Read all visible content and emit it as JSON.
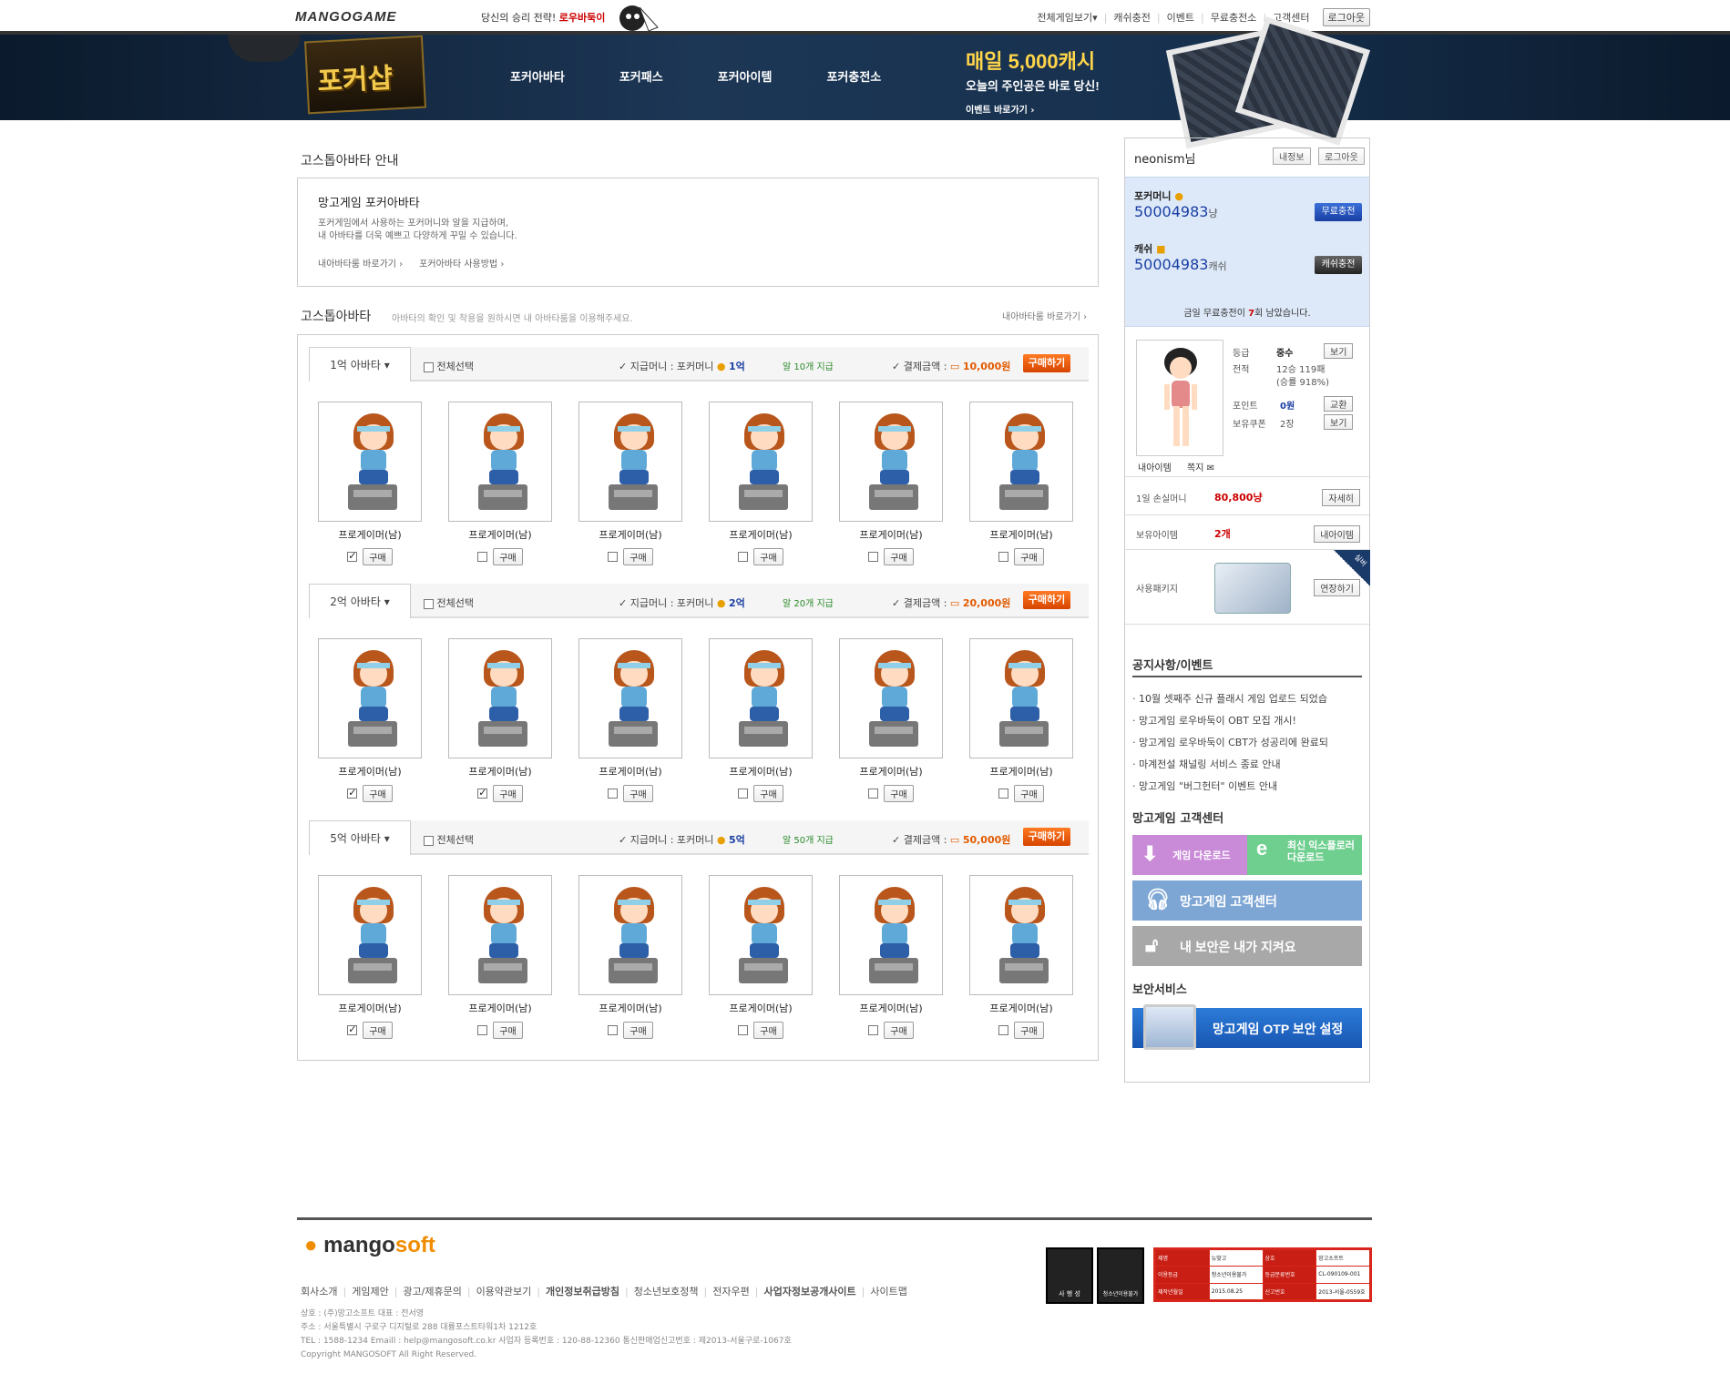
{
  "topbar": {
    "logo": "MANGOGAME",
    "promo_text": "당신의 승리 전략!",
    "promo_link": "로우바둑이",
    "nav": [
      "전체게임보기",
      "캐쉬충전",
      "이벤트",
      "무료충전소",
      "고객센터"
    ],
    "logout": "로그아웃"
  },
  "banner": {
    "shop_title": "포커샵",
    "nav": [
      "포커아바타",
      "포커패스",
      "포커아이템",
      "포커충전소"
    ],
    "promo_big": "매일 5,000캐시",
    "promo_mid": "오늘의 주인공은 바로 당신!",
    "promo_link": "이벤트 바로가기 ›"
  },
  "guide": {
    "section_title": "고스톱아바타 안내",
    "title": "망고게임 포커아바타",
    "desc1": "포커게임에서 사용하는 포커머니와 알을 지급하며,",
    "desc2": "내 아바타를 더욱 예쁘고 다양하게 꾸밀 수 있습니다.",
    "link1": "내아바타룸 바로가기 ›",
    "link2": "포커아바타 사용방법 ›"
  },
  "avatars": {
    "section_title": "고스톱아바타",
    "section_desc": "아바타의 확인 및 착용을 원하시면 내 아바타룸을 이용해주세요.",
    "section_link": "내아바타룸 바로가기 ›",
    "select_all": "전체선택",
    "money_label": "✓ 지급머니 : 포커머니",
    "pay_label": "✓ 결제금액 :",
    "buy_label": "구매하기",
    "item_buy": "구매",
    "item_name": "프로게이머(남)",
    "groups": [
      {
        "tab": "1억 아바타 ▾",
        "money": "1억",
        "egg": "알 10개 지급",
        "price": "10,000원",
        "checked": [
          true,
          false,
          false,
          false,
          false,
          false
        ]
      },
      {
        "tab": "2억 아바타 ▾",
        "money": "2억",
        "egg": "알 20개 지급",
        "price": "20,000원",
        "checked": [
          true,
          true,
          false,
          false,
          false,
          false
        ]
      },
      {
        "tab": "5억 아바타 ▾",
        "money": "5억",
        "egg": "알 50개 지급",
        "price": "50,000원",
        "checked": [
          true,
          false,
          false,
          false,
          false,
          false
        ]
      }
    ]
  },
  "sidebar": {
    "user": "neonism님",
    "myinfo": "내정보",
    "logout": "로그아웃",
    "poker_money_label": "포커머니",
    "poker_money_value": "50004983",
    "poker_money_unit": "냥",
    "free_charge": "무료충전",
    "cash_label": "캐쉬",
    "cash_value": "50004983",
    "cash_unit": "캐쉬",
    "cash_charge": "캐쉬충전",
    "free_msg_pre": "금일 무료충전이 ",
    "free_msg_count": "7",
    "free_msg_post": "회 남았습니다.",
    "grade_label": "등급",
    "grade_value": "중수",
    "record_label": "전적",
    "record_value": "12승 119패",
    "record_rate": "(승률 918%)",
    "point_label": "포인트",
    "point_value": "0원",
    "coupon_label": "보유쿠폰",
    "coupon_value": "2장",
    "view": "보기",
    "exchange": "교환",
    "my_item": "내아이템",
    "note": "쪽지",
    "loss_label": "1일 손실머니",
    "loss_value": "80,800냥",
    "loss_btn": "자세히",
    "items_label": "보유아이템",
    "items_value": "2개",
    "items_btn": "내아이템",
    "package_label": "사용패키지",
    "package_btn": "연장하기",
    "package_tag": "실버",
    "notice_title": "공지사항/이벤트",
    "notices": [
      "10월 셋째주 신규 플래시 게임 업로드 되었습",
      "망고게임 로우바둑이 OBT 모집 개시!",
      "망고게임 로우바둑이 CBT가 성공리에 완료되",
      "마계전설 채널링 서비스 종료 안내",
      "망고게임 \"버그헌터\" 이벤트 안내"
    ],
    "cs_title": "망고게임 고객센터",
    "download": "게임 다운로드",
    "explorer": "최신 익스플로러 다운로드",
    "cs_center": "망고게임 고객센터",
    "security": "내 보안은 내가 지켜요",
    "sec_title": "보안서비스",
    "otp": "망고게임 OTP 보안 설정"
  },
  "footer": {
    "logo_a": "mango",
    "logo_b": "soft",
    "links": [
      "회사소개",
      "게임제안",
      "광고/제휴문의",
      "이용약관보기",
      "개인정보취급방침",
      "청소년보호정책",
      "전자우편",
      "사업자정보공개사이트",
      "사이트맵"
    ],
    "info1": "상호 : (주)망고소프트 대표 : 전서영",
    "info2": "주소 : 서울특별시 구로구 디지털로 288 대륭포스트타워1차 1212호",
    "info3": "TEL : 1588-1234 Emaill : help@mangosoft.co.kr 사업자 등록번호 : 120-88-12360 통신판매업신고번호 : 제2013-서울구로-1067호",
    "info4": "Copyright MANGOSOFT All Right Reserved.",
    "rating_labels": [
      "사 행 성",
      "청소년이용불가"
    ],
    "table": [
      "제명",
      "뉴맞고",
      "상호",
      "망고소프트",
      "이용등급",
      "청소년이용불가",
      "등급분류번호",
      "CL-090109-001",
      "제작년월일",
      "2015.08.25",
      "신고번호",
      "2013-서울-0559호"
    ]
  },
  "colors": {
    "accent": "#e25a00",
    "blue": "#1a3fa3",
    "red": "#cc0000",
    "banner": "#1c3655"
  }
}
